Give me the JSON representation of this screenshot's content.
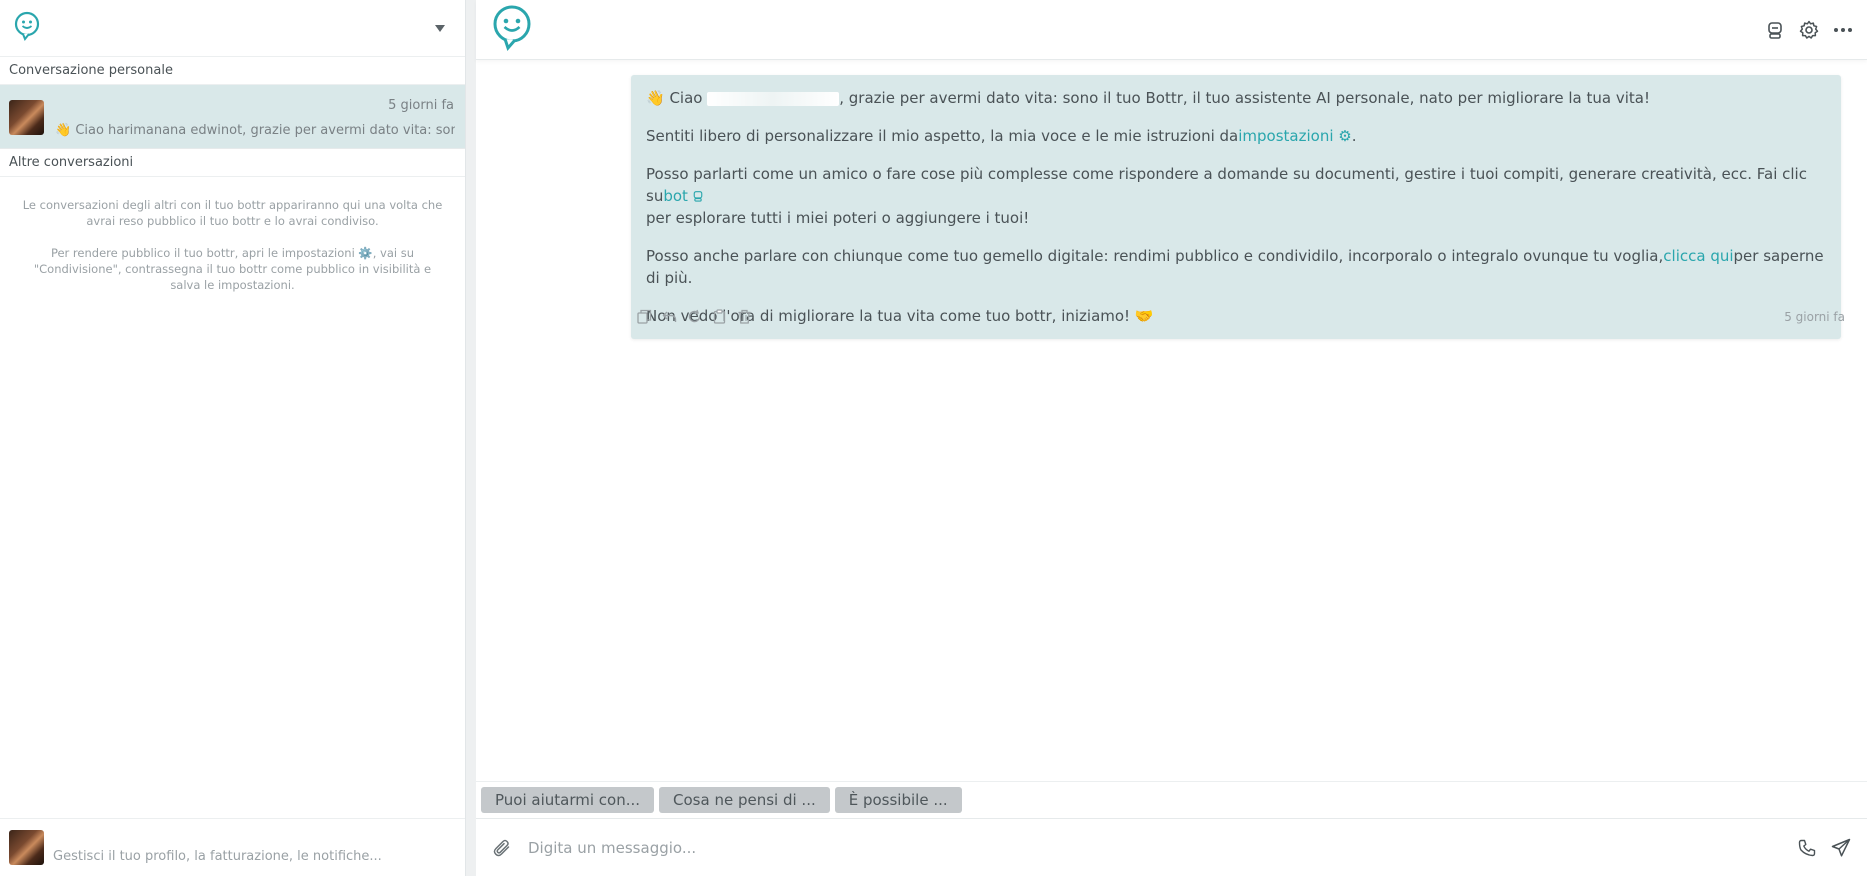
{
  "colors": {
    "accent": "#2aa6ad",
    "bubble": "#d9e8e9",
    "chip": "#c4c8cb"
  },
  "sidebar": {
    "logo_icon": "bottr-logo-icon",
    "menu_icon": "chevron-down-icon",
    "personal_label": "Conversazione personale",
    "conversation": {
      "time": "5 giorni fa",
      "preview": "👋 Ciao harimanana edwinot, grazie per avermi dato vita: sono il"
    },
    "others_label": "Altre conversazioni",
    "info_1": "Le conversazioni degli altri con il tuo bottr appariranno qui una volta che avrai reso pubblico il tuo bottr e lo avrai condiviso.",
    "info_2": "Per rendere pubblico il tuo bottr, apri le impostazioni ⚙️, vai su \"Condivisione\", contrassegna il tuo bottr come pubblico in visibilità e salva le impostazioni.",
    "footer_text": "Gestisci il tuo profilo, la fatturazione, le notifiche..."
  },
  "header": {
    "icons": [
      "bot-icon",
      "gear-icon",
      "more-icon"
    ]
  },
  "message": {
    "p1_a": "👋 Ciao ",
    "p1_b": ", grazie per avermi dato vita: sono il tuo Bottr, il tuo assistente AI personale, nato per migliorare la tua vita!",
    "p2_a": "Sentiti libero di personalizzare il mio aspetto, la mia voce e le mie istruzioni da",
    "p2_link": "impostazioni ⚙",
    "p2_b": ".",
    "p3_a": "Posso parlarti come un amico o fare cose più complesse come rispondere a domande su documenti, gestire i tuoi compiti, generare creatività, ecc. Fai clic su",
    "p3_link": "bot",
    "p3_b": "per esplorare tutti i miei poteri o aggiungere i tuoi!",
    "p4_a": "Posso anche parlare con chiunque come tuo gemello digitale: rendimi pubblico e condividilo, incorporalo o integralo ovunque tu voglia,",
    "p4_link": "clicca qui",
    "p4_b": "per saperne di più.",
    "p5": "Non vedo l'ora di migliorare la tua vita come tuo bottr, iniziamo! 🤝",
    "time": "5 giorni fa"
  },
  "suggestions": [
    "Puoi aiutarmi con...",
    "Cosa ne pensi di ...",
    "È possibile ..."
  ],
  "composer": {
    "placeholder": "Digita un messaggio..."
  }
}
